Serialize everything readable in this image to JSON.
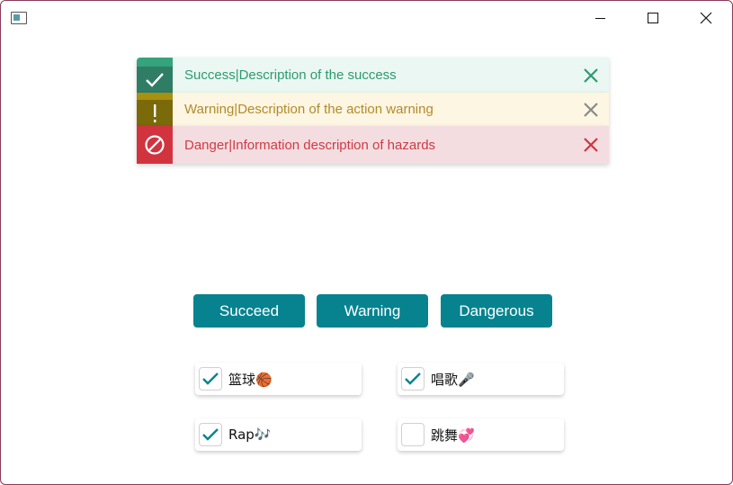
{
  "window": {
    "caption_buttons": [
      "minimize",
      "maximize",
      "close"
    ]
  },
  "alerts": [
    {
      "type": "success",
      "text": "Success|Description of the success",
      "icon": "check-icon"
    },
    {
      "type": "warning",
      "text": "Warning|Description of the action warning",
      "icon": "exclamation-icon"
    },
    {
      "type": "danger",
      "text": "Danger|Information description of hazards",
      "icon": "prohibited-icon"
    }
  ],
  "buttons": {
    "succeed": "Succeed",
    "warning": "Warning",
    "danger": "Dangerous"
  },
  "checkboxes": [
    {
      "label": "篮球🏀",
      "checked": true
    },
    {
      "label": "唱歌🎤",
      "checked": true
    },
    {
      "label": "Rap🎶",
      "checked": true
    },
    {
      "label": "跳舞💞",
      "checked": false
    }
  ],
  "colors": {
    "accent": "#07838f",
    "success": "#2e9a70",
    "warning": "#b38a2a",
    "danger": "#d1343f"
  }
}
